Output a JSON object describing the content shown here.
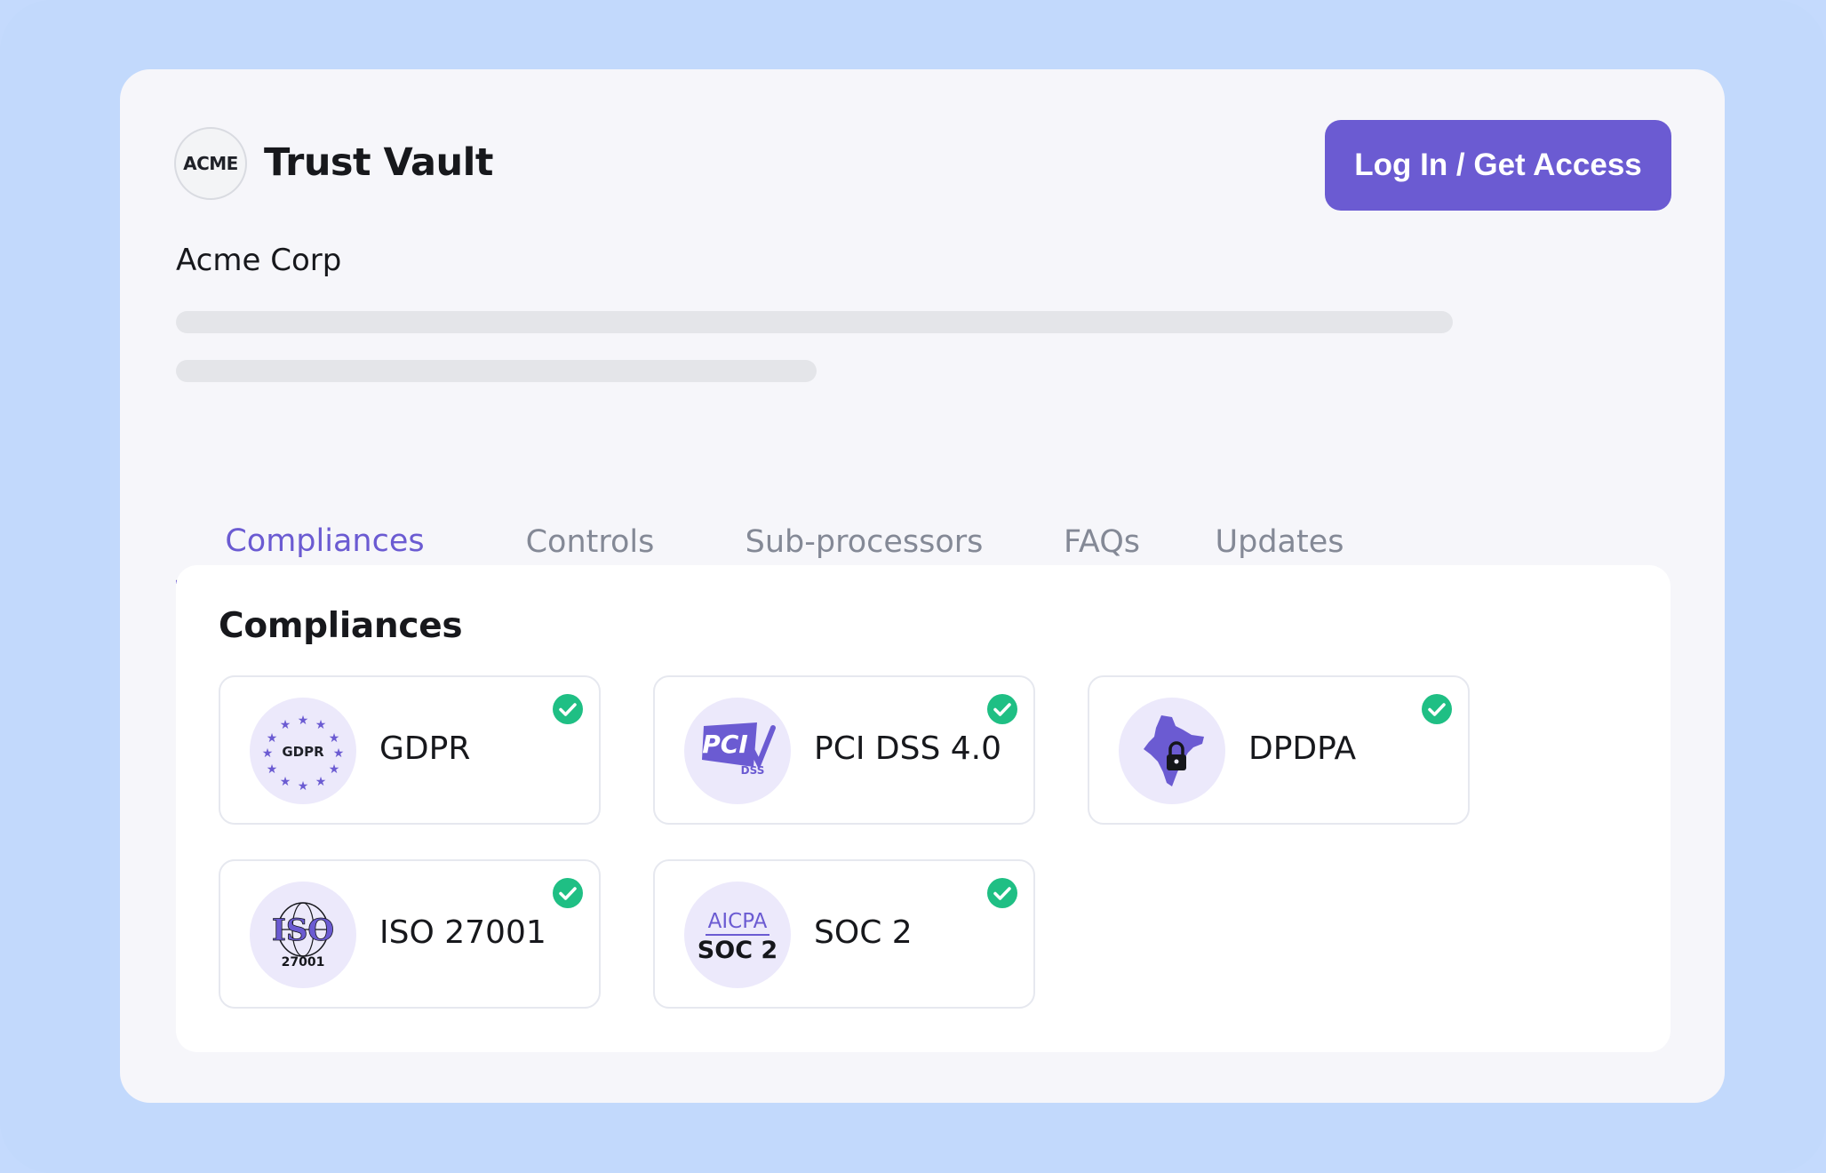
{
  "app": {
    "logo_text": "ACME",
    "title": "Trust Vault",
    "login_label": "Log In / Get Access",
    "org_name": "Acme Corp"
  },
  "tabs": [
    {
      "label": "Compliances",
      "active": true
    },
    {
      "label": "Controls",
      "active": false
    },
    {
      "label": "Sub-processors",
      "active": false
    },
    {
      "label": "FAQs",
      "active": false
    },
    {
      "label": "Updates",
      "active": false
    }
  ],
  "panel": {
    "title": "Compliances",
    "items": [
      {
        "name": "GDPR",
        "icon": "gdpr-icon",
        "badge_text": "GDPR",
        "verified": true
      },
      {
        "name": "PCI DSS 4.0",
        "icon": "pci-dss-icon",
        "badge_text": "PCI DSS",
        "verified": true
      },
      {
        "name": "DPDPA",
        "icon": "india-map-lock-icon",
        "verified": true
      },
      {
        "name": "ISO 27001",
        "icon": "iso-icon",
        "badge_text": "ISO 27001",
        "verified": true
      },
      {
        "name": "SOC 2",
        "icon": "aicpa-soc-icon",
        "badge_text": "AICPA SOC 2",
        "verified": true
      }
    ]
  },
  "colors": {
    "accent": "#6b5bd2",
    "check": "#1fbf84",
    "background": "#c2d9fc"
  }
}
